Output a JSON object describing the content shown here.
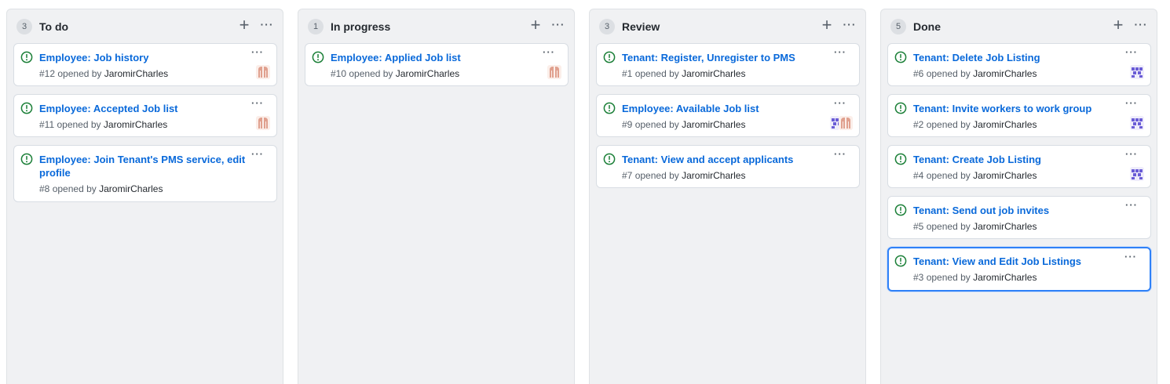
{
  "colors": {
    "issue_open": "#1a7f37",
    "link": "#0969da",
    "avatar_salmon": "#e0a08e",
    "avatar_purple": "#6a5cd6"
  },
  "columns": [
    {
      "count": "3",
      "title": "To do",
      "cards": [
        {
          "title": "Employee: Job history",
          "number": "#12",
          "opened_by": "opened by",
          "author": "JaromirCharles",
          "avatars": [
            "salmon"
          ]
        },
        {
          "title": "Employee: Accepted Job list",
          "number": "#11",
          "opened_by": "opened by",
          "author": "JaromirCharles",
          "avatars": [
            "salmon"
          ]
        },
        {
          "title": "Employee: Join Tenant's PMS service, edit profile",
          "number": "#8",
          "opened_by": "opened by",
          "author": "JaromirCharles",
          "avatars": []
        }
      ]
    },
    {
      "count": "1",
      "title": "In progress",
      "cards": [
        {
          "title": "Employee: Applied Job list",
          "number": "#10",
          "opened_by": "opened by",
          "author": "JaromirCharles",
          "avatars": [
            "salmon"
          ]
        }
      ]
    },
    {
      "count": "3",
      "title": "Review",
      "cards": [
        {
          "title": "Tenant: Register, Unregister to PMS",
          "number": "#1",
          "opened_by": "opened by",
          "author": "JaromirCharles",
          "avatars": []
        },
        {
          "title": "Employee: Available Job list",
          "number": "#9",
          "opened_by": "opened by",
          "author": "JaromirCharles",
          "avatars": [
            "purple",
            "salmon"
          ]
        },
        {
          "title": "Tenant: View and accept applicants",
          "number": "#7",
          "opened_by": "opened by",
          "author": "JaromirCharles",
          "avatars": []
        }
      ]
    },
    {
      "count": "5",
      "title": "Done",
      "cards": [
        {
          "title": "Tenant: Delete Job Listing",
          "number": "#6",
          "opened_by": "opened by",
          "author": "JaromirCharles",
          "avatars": [
            "purple"
          ]
        },
        {
          "title": "Tenant: Invite workers to work group",
          "number": "#2",
          "opened_by": "opened by",
          "author": "JaromirCharles",
          "avatars": [
            "purple"
          ]
        },
        {
          "title": "Tenant: Create Job Listing",
          "number": "#4",
          "opened_by": "opened by",
          "author": "JaromirCharles",
          "avatars": [
            "purple"
          ]
        },
        {
          "title": "Tenant: Send out job invites",
          "number": "#5",
          "opened_by": "opened by",
          "author": "JaromirCharles",
          "avatars": []
        },
        {
          "title": "Tenant: View and Edit Job Listings",
          "number": "#3",
          "opened_by": "opened by",
          "author": "JaromirCharles",
          "avatars": [],
          "selected": true
        }
      ]
    }
  ]
}
